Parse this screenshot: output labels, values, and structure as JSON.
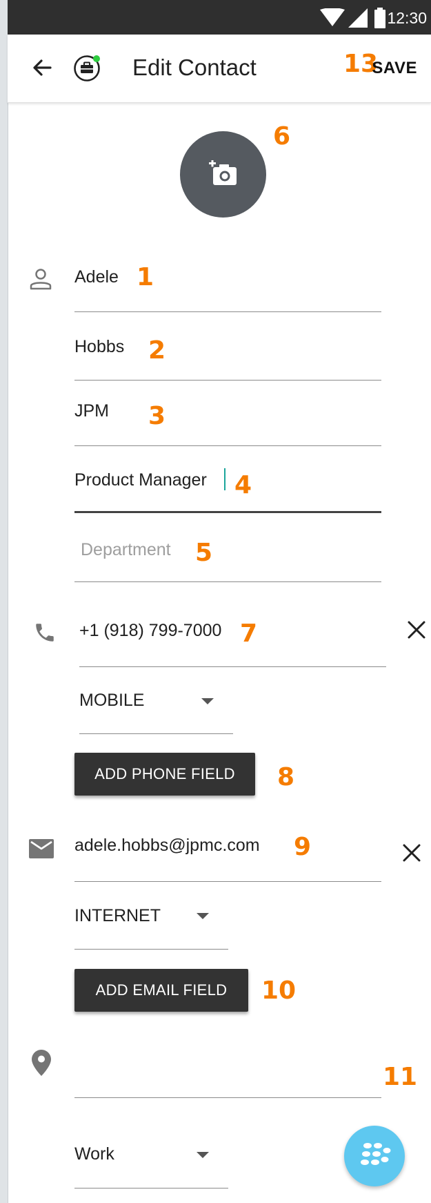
{
  "status_bar": {
    "time": "12:30"
  },
  "app_bar": {
    "title": "Edit Contact",
    "save_label": "SAVE",
    "save_annotation": "13"
  },
  "photo": {
    "annotation": "6"
  },
  "name_fields": [
    {
      "value": "Adele",
      "placeholder": "",
      "annotation": "1"
    },
    {
      "value": "Hobbs",
      "placeholder": "",
      "annotation": "2"
    },
    {
      "value": "JPM",
      "placeholder": "",
      "annotation": "3"
    },
    {
      "value": "Product Manager",
      "placeholder": "",
      "annotation": "4"
    },
    {
      "value": "",
      "placeholder": "Department",
      "annotation": "5"
    }
  ],
  "phone": {
    "value": "+1 (918) 799-7000",
    "annotation": "7",
    "type": "MOBILE",
    "add_label": "ADD PHONE FIELD",
    "add_annotation": "8"
  },
  "email": {
    "value": "adele.hobbs@jpmc.com",
    "annotation": "9",
    "type": "INTERNET",
    "add_label": "ADD EMAIL FIELD",
    "add_annotation": "10"
  },
  "address": {
    "value": "",
    "annotation": "11",
    "type": "Work"
  },
  "colors": {
    "accent": "#f57c00",
    "button_bg": "#333333",
    "fab": "#5ec8f0",
    "photo_bg": "#555a60",
    "cursor": "#1aa59a"
  },
  "icons": [
    "back-arrow-icon",
    "briefcase-icon",
    "add-photo-icon",
    "person-icon",
    "phone-icon",
    "email-icon",
    "location-pin-icon",
    "close-icon",
    "dropdown-arrow-icon",
    "blackberry-icon",
    "wifi-icon",
    "signal-icon",
    "battery-icon"
  ]
}
